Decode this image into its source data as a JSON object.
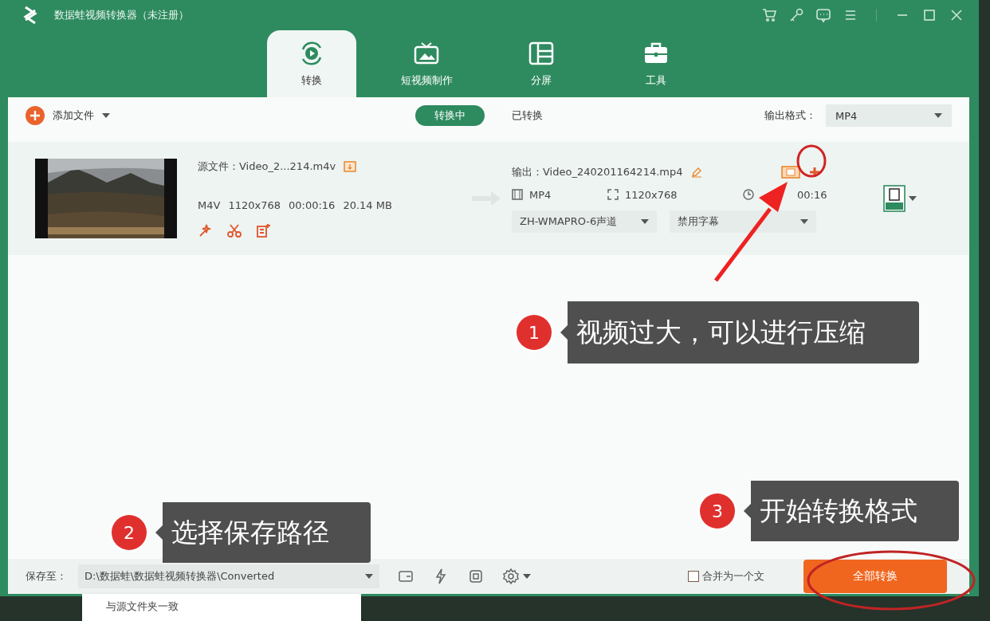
{
  "window": {
    "title": "数据蛙视频转换器（未注册）"
  },
  "nav_tabs": [
    {
      "label": "转换",
      "selected": true,
      "kind": "convert"
    },
    {
      "label": "短视频制作",
      "selected": false,
      "kind": "tv"
    },
    {
      "label": "分屏",
      "selected": false,
      "kind": "split"
    },
    {
      "label": "工具",
      "selected": false,
      "kind": "toolbox"
    }
  ],
  "toolbar": {
    "add_file": "添加文件",
    "status_tabs": [
      {
        "label": "转换中",
        "selected": true
      },
      {
        "label": "已转换",
        "selected": false
      }
    ],
    "output_format_label": "输出格式：",
    "output_format": "MP4"
  },
  "file": {
    "source": "源文件：Video_2...214.m4v",
    "meta": [
      "M4V",
      "1120x768",
      "00:00:16",
      "20.14 MB"
    ],
    "output": "输出：Video_240201164214.mp4",
    "target_format": "MP4",
    "target_resolution": "1120x768",
    "target_duration": "00:16",
    "audio_track": "ZH-WMAPRO-6声道",
    "subtitle": "禁用字幕"
  },
  "bottom_bar": {
    "save_label": "保存至：",
    "save_path": "D:\\数据蛙\\数据蛙视频转换器\\Converted",
    "path_option": "与源文件夹一致",
    "merge": {
      "label": "合并为一个文",
      "checked": false
    },
    "convert_all": "全部转换"
  },
  "annotations": [
    {
      "number": "1",
      "text": "视频过大，可以进行压缩"
    },
    {
      "number": "2",
      "text": "选择保存路径"
    },
    {
      "number": "3",
      "text": "开始转换格式"
    }
  ]
}
